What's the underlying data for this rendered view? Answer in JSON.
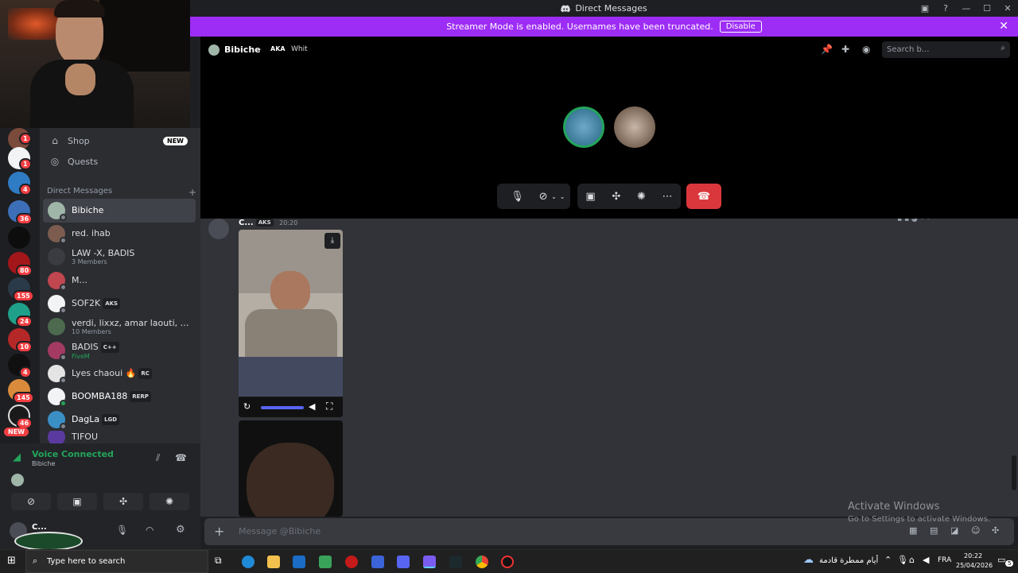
{
  "window": {
    "title": "Direct Messages",
    "controls": [
      "minimize",
      "maximize",
      "close"
    ]
  },
  "banner": {
    "text": "Streamer Mode is enabled. Usernames have been truncated.",
    "button": "Disable"
  },
  "sidebar": {
    "nav": [
      {
        "label": "Shop",
        "badge": "NEW",
        "icon": "shop-icon"
      },
      {
        "label": "Quests",
        "icon": "quests-icon"
      }
    ],
    "dm_header": "Direct Messages",
    "dms": [
      {
        "name": "Bibiche",
        "selected": true
      },
      {
        "name": "red. ihab"
      },
      {
        "name": "LAW -X, BADIS",
        "sub": "3 Members"
      },
      {
        "name": "M..."
      },
      {
        "name": "SOF2K",
        "tag": "AKS"
      },
      {
        "name": "verdi, lixxz, amar laouti, Louai c...",
        "sub": "10 Members"
      },
      {
        "name": "BADIS",
        "tag": "C++",
        "sub": "FiveM"
      },
      {
        "name": "Lyes chaoui 🔥",
        "tag": "RC"
      },
      {
        "name": "BOOMBA188",
        "tag": "RERP"
      },
      {
        "name": "DagLa",
        "tag": "LGD"
      },
      {
        "name": "TIFOU"
      }
    ]
  },
  "servers": {
    "badges": [
      "1",
      "1",
      "4",
      "36",
      "80",
      "155",
      "24",
      "10",
      "4",
      "145",
      "46"
    ],
    "new_label": "NEW"
  },
  "voice": {
    "status": "Voice Connected",
    "channel": "Bibiche"
  },
  "user": {
    "name": "C..."
  },
  "call": {
    "user": "Bibiche",
    "aka_label": "AKA",
    "aka_value": "Whit",
    "search_placeholder": "Search b..."
  },
  "message": {
    "author": "C...",
    "tag": "AKS",
    "time": "20:20"
  },
  "composer": {
    "placeholder": "Message @Bibiche"
  },
  "watermark": {
    "title": "Activate Windows",
    "subtitle": "Go to Settings to activate Windows."
  },
  "taskbar": {
    "search_placeholder": "Type here to search",
    "weather": "أيام ممطرة قادمة",
    "language": "FRA",
    "time": "20:22",
    "date": "25/04/2026",
    "notifications": "5"
  }
}
